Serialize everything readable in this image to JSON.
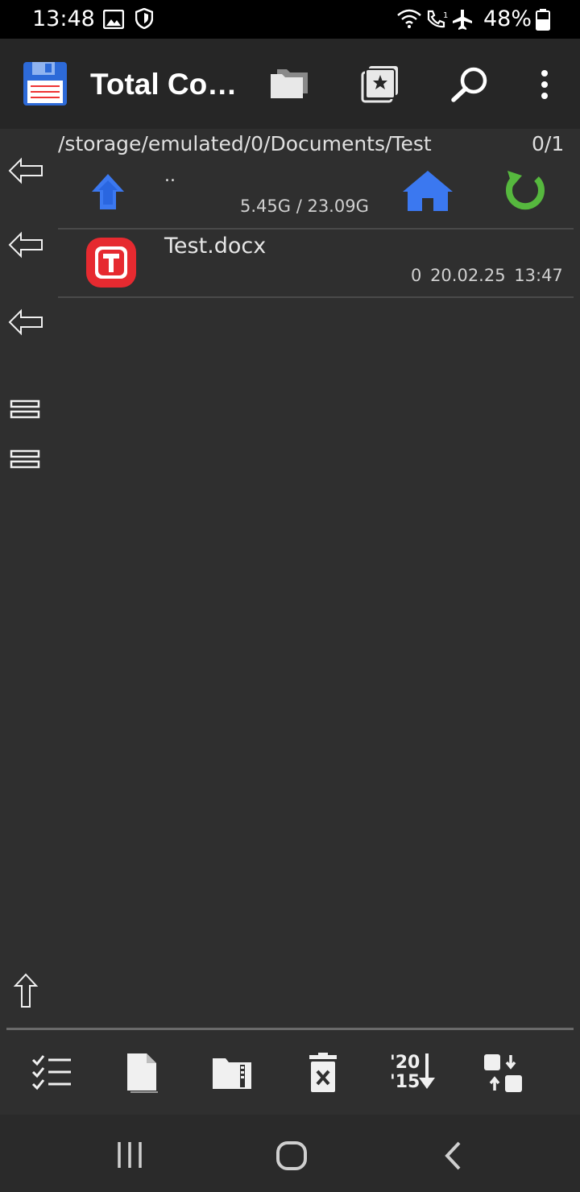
{
  "status_bar": {
    "time": "13:48",
    "battery": "48%",
    "icons": [
      "gallery-icon",
      "shield-icon",
      "wifi-icon",
      "wifi-calling-icon",
      "airplane-icon",
      "battery-icon"
    ]
  },
  "app_bar": {
    "title": "Total Co…",
    "icons": [
      "save-icon",
      "folders-icon",
      "bookmarks-icon",
      "search-icon",
      "more-vert-icon"
    ]
  },
  "panel": {
    "path": "/storage/emulated/0/Documents/Test",
    "selection_count": "0/1",
    "parent_entry": "..",
    "disk_space": "5.45G / 23.09G"
  },
  "files": [
    {
      "name": "Test.docx",
      "size": "0",
      "date": "20.02.25",
      "time": "13:47",
      "icon": "document-app-icon"
    }
  ],
  "toolbar": {
    "icons": [
      "select-multiple-icon",
      "new-file-icon",
      "archive-folder-icon",
      "delete-icon",
      "sort-by-date-icon",
      "swap-panels-icon"
    ]
  },
  "colors": {
    "background": "#2f2f2f",
    "app_bar": "#262626",
    "accent_blue": "#3b78f0",
    "accent_green": "#56b83e",
    "file_icon_red": "#e62a30"
  }
}
